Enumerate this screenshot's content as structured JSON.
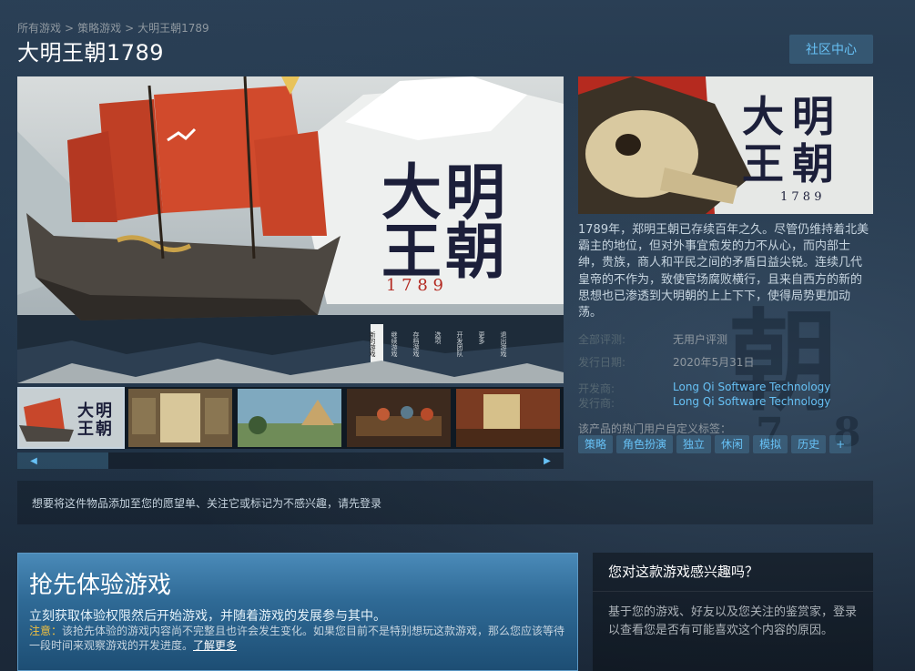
{
  "breadcrumb": [
    "所有游戏",
    "策略游戏",
    "大明王朝1789"
  ],
  "breadcrumb_sep": ">",
  "title": "大明王朝1789",
  "community_button": "社区中心",
  "hero": {
    "logo_chars": [
      "大",
      "明",
      "王",
      "朝"
    ],
    "logo_year": "1 7 8 9",
    "menu_items": [
      "新的游戏",
      "继续游戏",
      "存档游戏",
      "选项",
      "开发团队",
      "更多",
      "退出游戏"
    ]
  },
  "capsule": {
    "logo_chars": [
      "大",
      "明",
      "王",
      "朝"
    ],
    "logo_year": "1 7 8 9"
  },
  "description": "1789年，郑明王朝已存续百年之久。尽管仍维持着北美霸主的地位，但对外事宜愈发的力不从心，而内部士绅，贵族，商人和平民之间的矛盾日益尖锐。连续几代皇帝的不作为，致使官场腐败横行，且来自西方的新的思想也已渗透到大明朝的上上下下，使得局势更加动荡。",
  "reviews": {
    "label": "全部评测:",
    "value": "无用户评测"
  },
  "release": {
    "label": "发行日期:",
    "value": "2020年5月31日"
  },
  "developer": {
    "label": "开发商:",
    "value": "Long Qi Software Technology"
  },
  "publisher": {
    "label": "发行商:",
    "value": "Long Qi Software Technology"
  },
  "tags_label": "该产品的热门用户自定义标签：",
  "tags": [
    "策略",
    "角色扮演",
    "独立",
    "休闲",
    "模拟",
    "历史",
    "+"
  ],
  "thumbnail_logo_chars": [
    "大",
    "明",
    "王",
    "朝"
  ],
  "scroll_left": "◀",
  "scroll_right": "▶",
  "login_prompt": "想要将这件物品添加至您的愿望单、关注它或标记为不感兴趣，请先登录",
  "early_access": {
    "title": "抢先体验游戏",
    "subtitle": "立刻获取体验权限然后开始游戏，并随着游戏的发展参与其中。",
    "note_label": "注意：",
    "note": "该抢先体验的游戏内容尚不完整且也许会发生变化。如果您目前不是特别想玩这款游戏，那么您应该等待一段时间来观察游戏的开发进度。",
    "learn_more": "了解更多"
  },
  "interest": {
    "title": "您对这款游戏感兴趣吗？",
    "text": "基于您的游戏、好友以及您关注的鉴赏家，登录以查看您是否有可能喜欢这个内容的原因。"
  },
  "background_chars": [
    "朝",
    "7",
    "8"
  ],
  "colors": {
    "accent_link": "#67c1f5",
    "background": "#1b2838",
    "early_access_blue": "#2f6a96",
    "note_yellow": "#f0c040"
  }
}
